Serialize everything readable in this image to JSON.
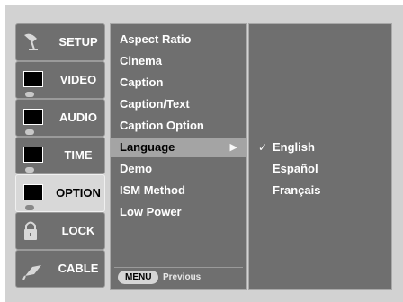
{
  "sidebar": {
    "tabs": [
      {
        "label": "SETUP",
        "icon": "satellite-dish-icon"
      },
      {
        "label": "VIDEO",
        "icon": "screen-icon"
      },
      {
        "label": "AUDIO",
        "icon": "screen-icon"
      },
      {
        "label": "TIME",
        "icon": "screen-icon"
      },
      {
        "label": "OPTION",
        "icon": "screen-icon",
        "active": true
      },
      {
        "label": "LOCK",
        "icon": "padlock-icon"
      },
      {
        "label": "CABLE",
        "icon": "cable-icon"
      }
    ]
  },
  "menu": {
    "items": [
      "Aspect Ratio",
      "Cinema",
      "Caption",
      "Caption/Text",
      "Caption Option",
      "Language",
      "Demo",
      "ISM Method",
      "Low Power"
    ],
    "selected_index": 5,
    "arrow": "▶"
  },
  "hint": {
    "key": "MENU",
    "text": "Previous"
  },
  "languages": {
    "items": [
      "English",
      "Español",
      "Français"
    ],
    "checked_index": 0,
    "check_mark": "✓"
  },
  "colors": {
    "panel": "#6f6f6f",
    "selected": "#a4a4a4",
    "background": "#d2d2d2"
  }
}
